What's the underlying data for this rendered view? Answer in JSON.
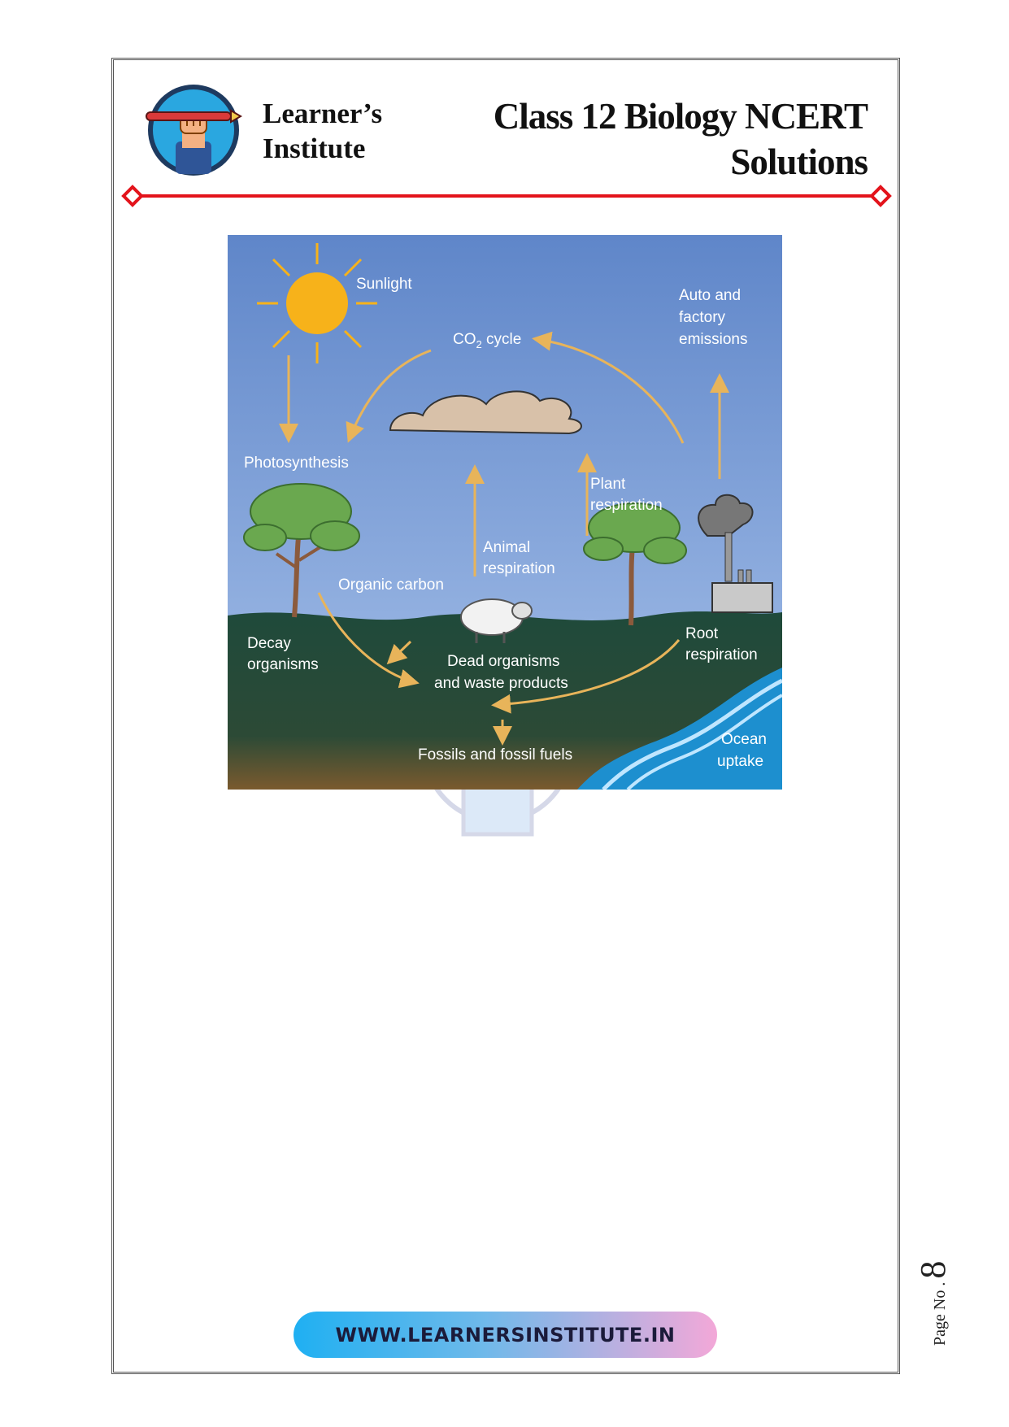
{
  "header": {
    "brand_line1": "Learner’s",
    "brand_line2": "Institute",
    "title_line1": "Class 12 Biology NCERT",
    "title_line2": "Solutions"
  },
  "diagram": {
    "labels": {
      "sunlight": "Sunlight",
      "co2_cycle_prefix": "CO",
      "co2_cycle_sub": "2",
      "co2_cycle_suffix": " cycle",
      "auto_line1": "Auto  and",
      "auto_line2": "factory",
      "auto_line3": "emissions",
      "photosynthesis": "Photosynthesis",
      "plant_line1": "Plant",
      "plant_line2": "respiration",
      "animal_line1": "Animal",
      "animal_line2": "respiration",
      "organic_carbon": "Organic  carbon",
      "decay_line1": "Decay",
      "decay_line2": "organisms",
      "dead_line1": "Dead  organisms",
      "dead_line2": "and  waste  products",
      "root_line1": "Root",
      "root_line2": "respiration",
      "fossils": "Fossils  and  fossil  fuels",
      "ocean_line1": "Ocean",
      "ocean_line2": "uptake"
    },
    "colors": {
      "sky_top": "#5f86c9",
      "sky_bottom": "#a8c2ea",
      "ground_top": "#1f4a3b",
      "ground_bottom": "#7a5a2e",
      "arrow": "#e8b45a",
      "sun": "#f7b21a",
      "ocean": "#1d8fcf"
    }
  },
  "footer": {
    "website": "WWW.LEARNERSINSTITUTE.IN",
    "page_label": "Page No .",
    "page_number": "8"
  },
  "theme": {
    "rule_color": "#e3131b"
  }
}
